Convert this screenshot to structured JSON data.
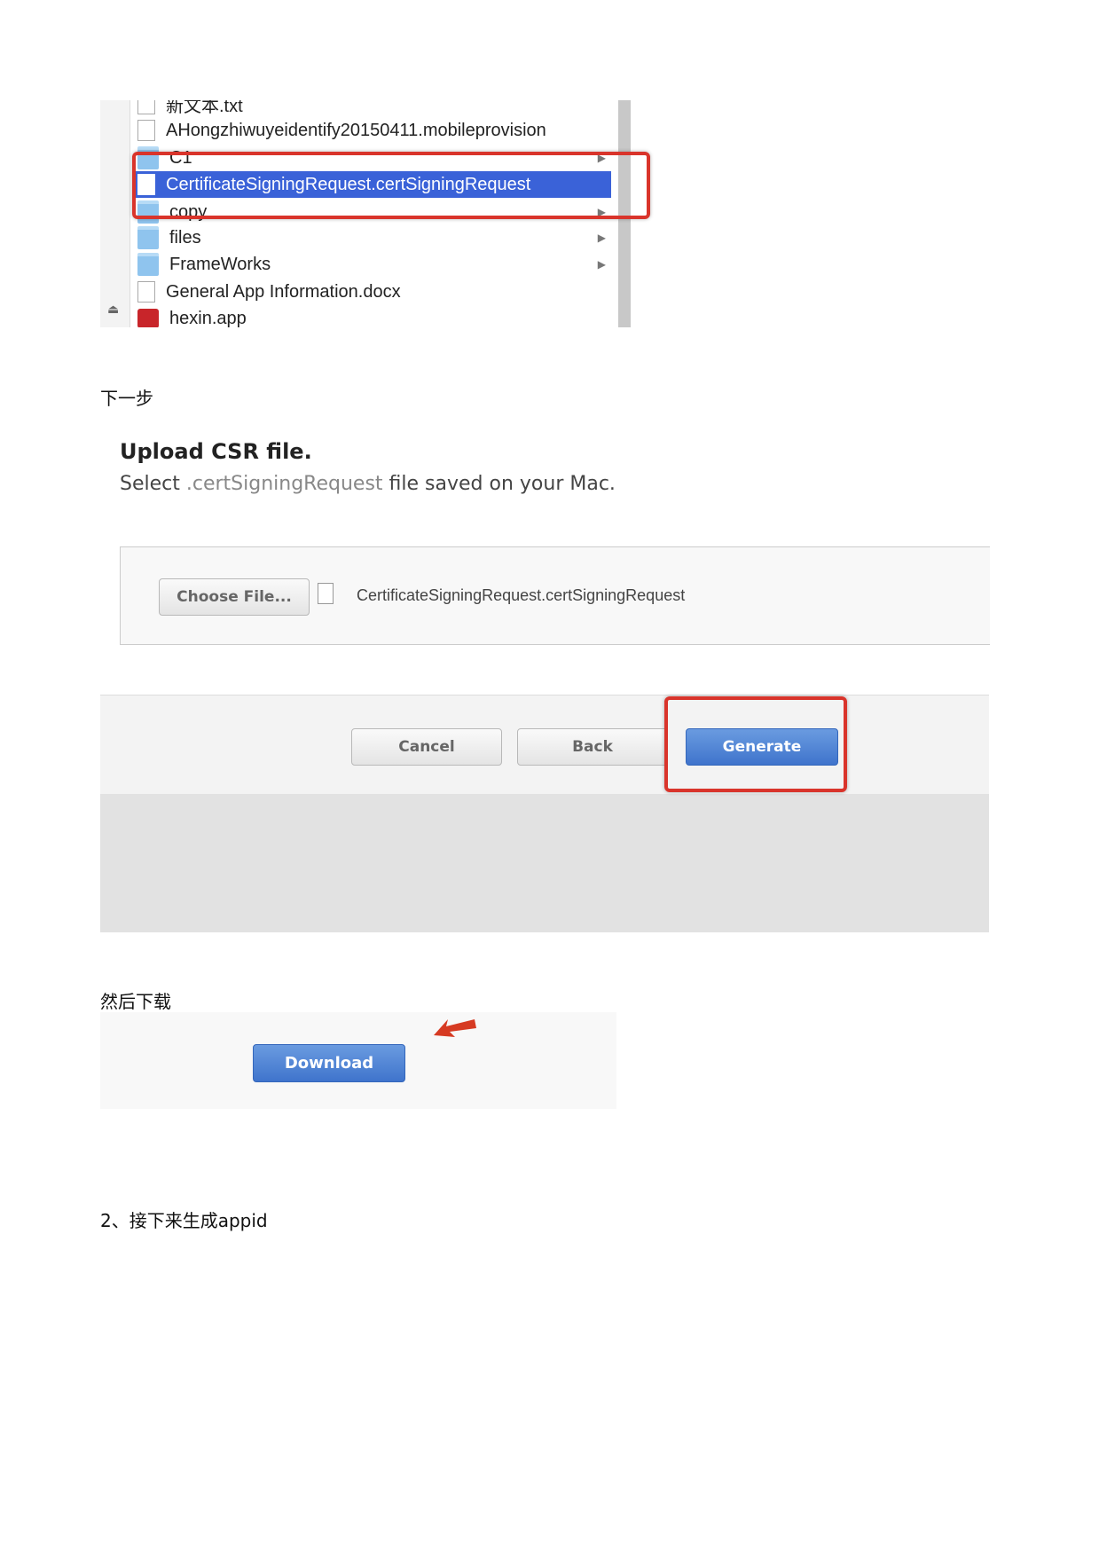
{
  "finder": {
    "rows": [
      {
        "label": "新文本.txt",
        "icon": "text-file-icon"
      },
      {
        "label": "AHongzhiwuyeidentify20150411.mobileprovision",
        "icon": "provision-file-icon"
      },
      {
        "label": "C1",
        "icon": "folder-icon"
      },
      {
        "label": "CertificateSigningRequest.certSigningRequest",
        "icon": "document-icon",
        "selected": true
      },
      {
        "label": "copy",
        "icon": "folder-icon"
      },
      {
        "label": "files",
        "icon": "folder-icon"
      },
      {
        "label": "FrameWorks",
        "icon": "folder-icon"
      },
      {
        "label": "General App Information.docx",
        "icon": "word-document-icon"
      },
      {
        "label": "hexin.app",
        "icon": "app-icon"
      }
    ],
    "highlight_color": "#d9342b",
    "selection_color": "#3a62d8"
  },
  "step_next": "下一步",
  "upload": {
    "title": "Upload CSR file.",
    "desc_prefix": "Select ",
    "desc_ext": ".certSigningRequest",
    "desc_suffix": " file saved on your Mac.",
    "choose_button": "Choose File...",
    "file_name": "CertificateSigningRequest.certSigningRequest"
  },
  "actions": {
    "cancel": "Cancel",
    "back": "Back",
    "generate": "Generate"
  },
  "then_download": "然后下载",
  "download_button": "Download",
  "step2": "2、接下来生成appid"
}
